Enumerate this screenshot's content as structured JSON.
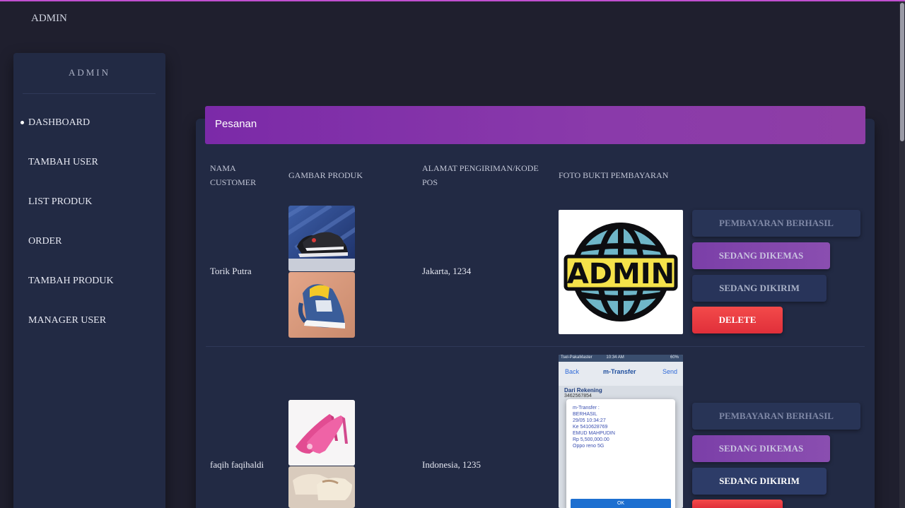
{
  "topbar": {
    "title": "ADMIN"
  },
  "sidebar": {
    "brand": "ADMIN",
    "items": [
      {
        "label": "DASHBOARD",
        "active": true
      },
      {
        "label": "TAMBAH USER"
      },
      {
        "label": "LIST PRODUK"
      },
      {
        "label": "ORDER"
      },
      {
        "label": "TAMBAH PRODUK"
      },
      {
        "label": "MANAGER USER"
      }
    ]
  },
  "card": {
    "title": "Pesanan"
  },
  "table": {
    "headers": {
      "customer": "NAMA CUSTOMER",
      "product_image": "GAMBAR PRODUK",
      "address": "ALAMAT PENGIRIMAN/KODE POS",
      "payment_proof": "FOTO BUKTI PEMBAYARAN"
    },
    "rows": [
      {
        "customer": "Torik Putra",
        "address": "Jakarta, 1234",
        "proof_logo_text": "ADMIN"
      },
      {
        "customer": "faqih faqihaldi",
        "address": "Indonesia, 1235",
        "receipt": {
          "status_bar": "Tsel-PakaMaster",
          "time": "10:34 AM",
          "battery": "60%",
          "back": "Back",
          "title": "m-Transfer",
          "send": "Send",
          "from_label": "Dari Rekening",
          "account": "3462567854",
          "lines": [
            "m-Transfer :",
            "BERHASIL",
            "29/05 10:34:27",
            "Ke 5410628769",
            "EMUD MAHPUDIN",
            "Rp 5,500,000.00",
            "Oppo reno 5G"
          ],
          "ok": "OK"
        }
      }
    ]
  },
  "buttons": {
    "paid": "PEMBAYARAN BERHASIL",
    "packing": "SEDANG DIKEMAS",
    "shipping": "SEDANG DIKIRIM",
    "delete": "DELETE"
  },
  "colors": {
    "accent": "#8a3aaa",
    "background": "#1f1f2e",
    "panel": "#222a44",
    "delete": "#ef3b45"
  }
}
